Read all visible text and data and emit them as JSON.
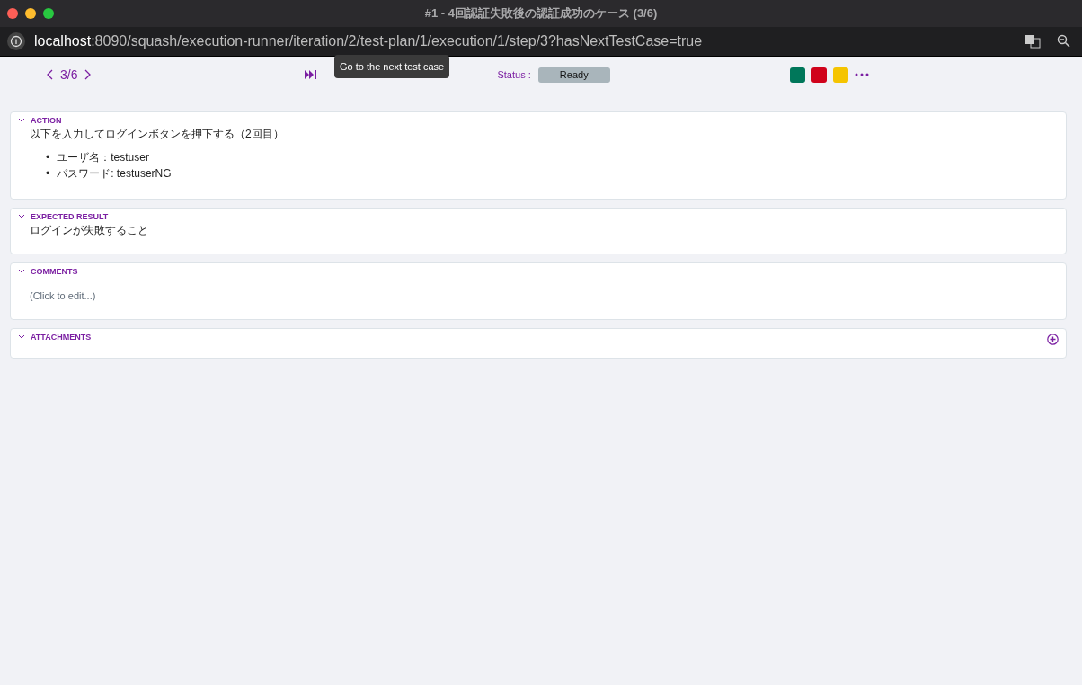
{
  "window": {
    "title": "#1 - 4回認証失敗後の認証成功のケース (3/6)"
  },
  "address_bar": {
    "host": "localhost",
    "path": ":8090/squash/execution-runner/iteration/2/test-plan/1/execution/1/step/3?hasNextTestCase=true"
  },
  "toolbar": {
    "step_counter": "3/6",
    "tooltip": "Go to the next test case",
    "status_label": "Status :",
    "status_value": "Ready",
    "status_buttons": [
      {
        "color": "#00775a"
      },
      {
        "color": "#d0021b"
      },
      {
        "color": "#f5c400"
      }
    ]
  },
  "sections": [
    {
      "kind": "rich",
      "title": "ACTION",
      "expanded": true,
      "text": "以下を入力してログインボタンを押下する（2回目）",
      "bullets": [
        {
          "marker": "•",
          "text": "ユーザ名：testuser"
        },
        {
          "marker": "•",
          "text": "パスワード: testuserNG"
        }
      ]
    },
    {
      "kind": "rich",
      "title": "EXPECTED RESULT",
      "expanded": true,
      "text": "ログインが失敗すること"
    },
    {
      "kind": "editable",
      "title": "COMMENTS",
      "expanded": true,
      "placeholder": "(Click to edit...)"
    },
    {
      "kind": "attachments",
      "title": "ATTACHMENTS",
      "expanded": true
    }
  ]
}
